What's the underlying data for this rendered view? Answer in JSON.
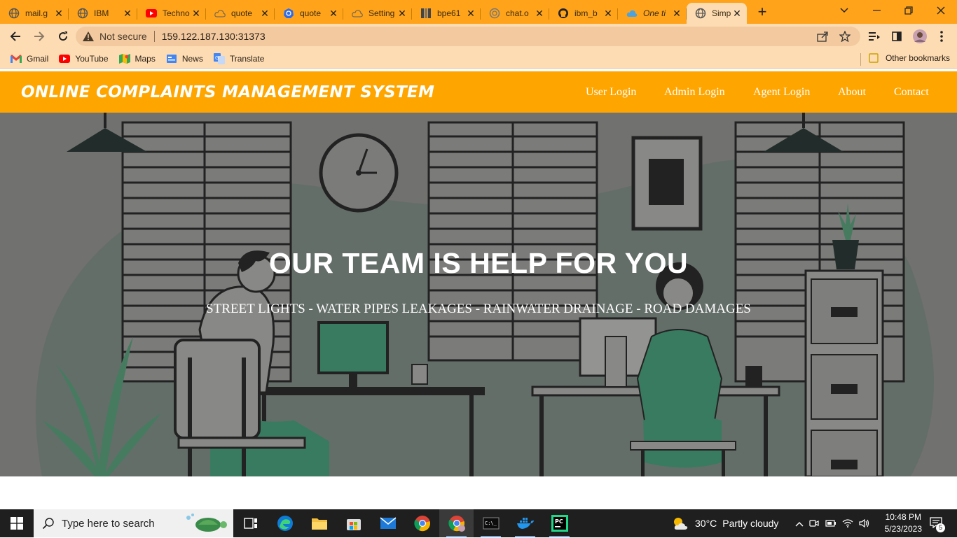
{
  "browser": {
    "tabs": [
      {
        "title": "mail.g",
        "icon": "globe-icon"
      },
      {
        "title": "IBM",
        "icon": "globe-icon"
      },
      {
        "title": "Techno",
        "icon": "youtube-icon"
      },
      {
        "title": "quote",
        "icon": "cloud-icon"
      },
      {
        "title": "quote",
        "icon": "kubernetes-icon"
      },
      {
        "title": "Setting",
        "icon": "cloud-icon"
      },
      {
        "title": "bpe61",
        "icon": "grid-icon"
      },
      {
        "title": "chat.o",
        "icon": "openai-icon"
      },
      {
        "title": "ibm_b",
        "icon": "github-icon"
      },
      {
        "title": "One ti",
        "icon": "ibm-cloud-icon"
      },
      {
        "title": "Simple",
        "icon": "globe-icon",
        "active": true
      }
    ],
    "security_label": "Not secure",
    "url": "159.122.187.130:31373",
    "bookmarks": [
      {
        "label": "Gmail",
        "icon": "gmail-icon"
      },
      {
        "label": "YouTube",
        "icon": "youtube-icon"
      },
      {
        "label": "Maps",
        "icon": "maps-icon"
      },
      {
        "label": "News",
        "icon": "news-icon"
      },
      {
        "label": "Translate",
        "icon": "translate-icon"
      }
    ],
    "other_bookmarks": "Other bookmarks",
    "accent_color": "#ffa31a"
  },
  "site": {
    "brand": "ONLINE COMPLAINTS MANAGEMENT SYSTEM",
    "nav": [
      "User Login",
      "Admin Login",
      "Agent Login",
      "About",
      "Contact"
    ],
    "hero_title": "OUR TEAM IS HELP FOR YOU",
    "hero_subtitle": "STREET LIGHTS - WATER PIPES LEAKAGES - RAINWATER DRAINAGE - ROAD DAMAGES",
    "nav_color": "#ffa500"
  },
  "taskbar": {
    "search_placeholder": "Type here to search",
    "apps": [
      "task-view-icon",
      "edge-icon",
      "file-explorer-icon",
      "store-icon",
      "mail-icon",
      "chrome-icon",
      "chrome-profile-icon",
      "terminal-icon",
      "docker-icon",
      "pycharm-icon"
    ],
    "weather_temp": "30°C",
    "weather_text": "Partly cloudy",
    "time": "10:48 PM",
    "date": "5/23/2023",
    "notification_count": "5"
  }
}
